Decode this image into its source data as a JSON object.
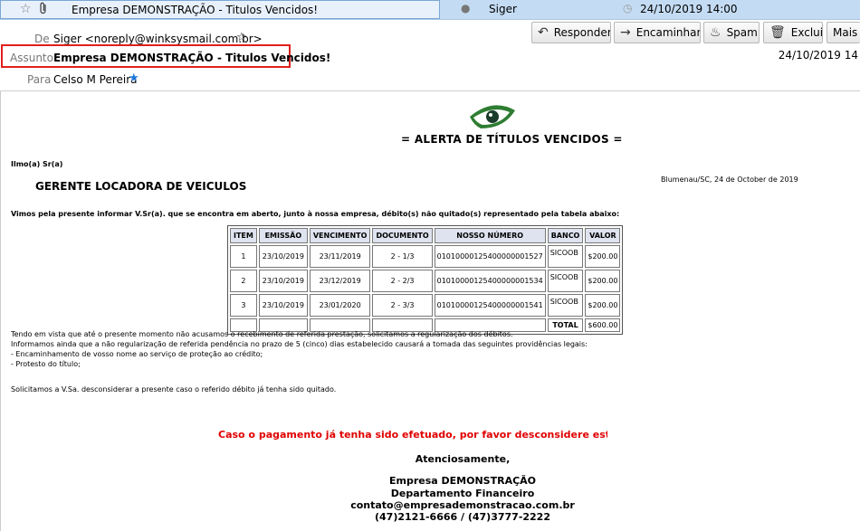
{
  "message_list": {
    "subject": "Empresa DEMONSTRAÇÃO - Titulos Vencidos!",
    "from": "Siger",
    "date": "24/10/2019 14:00"
  },
  "header": {
    "from_label": "De",
    "from_value": "Siger <noreply@winksysmail.com.br>",
    "subject_label": "Assunto",
    "subject_value": "Empresa DEMONSTRAÇÃO - Titulos Vencidos!",
    "to_label": "Para",
    "to_value": "Celso M Pereira",
    "date": "24/10/2019 14",
    "toolbar": {
      "reply": "Responder",
      "forward": "Encaminhar",
      "spam": "Spam",
      "delete": "Excluir",
      "more": "Mais"
    }
  },
  "email": {
    "title": "= ALERTA DE TÍTULOS VENCIDOS =",
    "salutation": "Ilmo(a) Sr(a)",
    "recipient": "GERENTE LOCADORA DE VEICULOS",
    "place_date": "Blumenau/SC, 24 de October de 2019",
    "intro": "Vimos pela presente informar V.Sr(a). que se encontra em aberto, junto à nossa empresa, débito(s) não quitado(s) representado pela tabela abaixo:",
    "table": {
      "headers": [
        "ITEM",
        "EMISSÃO",
        "VENCIMENTO",
        "DOCUMENTO",
        "NOSSO NÚMERO",
        "BANCO",
        "VALOR"
      ],
      "rows": [
        [
          "1",
          "23/10/2019",
          "23/11/2019",
          "2 - 1/3",
          "01010000125400000001527",
          "SICOOB",
          "$200.00"
        ],
        [
          "2",
          "23/10/2019",
          "23/12/2019",
          "2 - 2/3",
          "01010000125400000001534",
          "SICOOB",
          "$200.00"
        ],
        [
          "3",
          "23/10/2019",
          "23/01/2020",
          "2 - 3/3",
          "01010000125400000001541",
          "SICOOB",
          "$200.00"
        ]
      ],
      "total_label": "TOTAL",
      "total_value": "$600.00"
    },
    "para1": "Tendo em vista que até o presente momento não acusamos o recebimento de referida prestação, solicitamos a regularização dos débitos.",
    "para2": "Informamos ainda que a não regularização de referida pendência no prazo de 5 (cinco) dias estabelecido causará a tomada das seguintes providências legais:",
    "bullet1": "- Encaminhamento de vosso nome ao serviço de proteção ao crédito;",
    "bullet2": "- Protesto do título;",
    "para3": "Solicitamos a V.Sa. desconsiderar a presente caso o referido débito já tenha sido quitado.",
    "red_notice": "Caso o pagamento já tenha sido efetuado, por favor desconsidere este aviso",
    "closing": "Atenciosamente,",
    "company": "Empresa DEMONSTRAÇÃO",
    "department": "Departamento Financeiro",
    "contact_email": "contato@empresademonstracao.com.br",
    "phones": "(47)2121-6666 / (47)3777-2222"
  },
  "colors": {
    "list_selected": "#c4dcf3",
    "highlight_box": "#e0201c",
    "notice_red": "#e00000",
    "table_header": "#dfe3ef"
  }
}
